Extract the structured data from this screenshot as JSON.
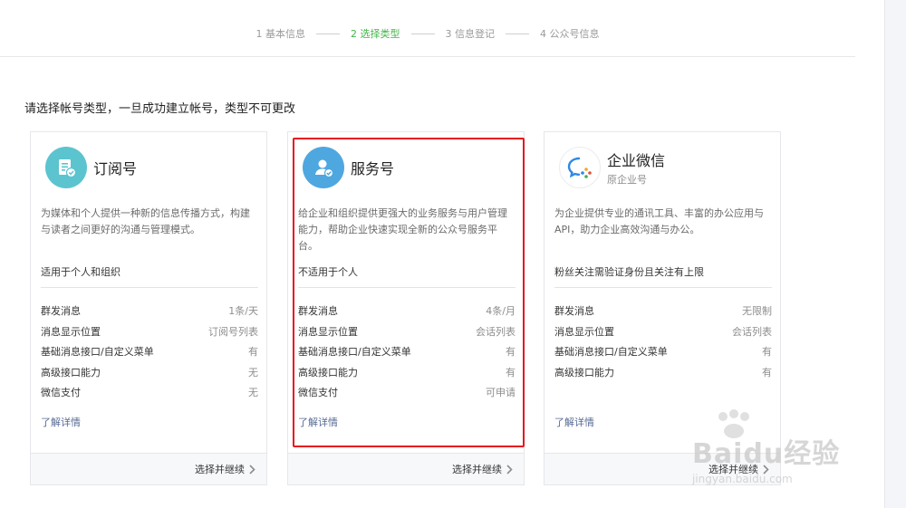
{
  "steps": [
    {
      "label": "1 基本信息",
      "active": false
    },
    {
      "label": "2 选择类型",
      "active": true
    },
    {
      "label": "3 信息登记",
      "active": false
    },
    {
      "label": "4 公众号信息",
      "active": false
    }
  ],
  "page_title": "请选择帐号类型，一旦成功建立帐号，类型不可更改",
  "cards": [
    {
      "name": "订阅号",
      "subtitle": "",
      "icon": "subscription-doc-icon",
      "icon_color": "#5bc4cf",
      "desc": "为媒体和个人提供一种新的信息传播方式，构建与读者之间更好的沟通与管理模式。",
      "fit": "适用于个人和组织",
      "features": [
        {
          "label": "群发消息",
          "value": "1条/天"
        },
        {
          "label": "消息显示位置",
          "value": "订阅号列表"
        },
        {
          "label": "基础消息接口/自定义菜单",
          "value": "有"
        },
        {
          "label": "高级接口能力",
          "value": "无"
        },
        {
          "label": "微信支付",
          "value": "无"
        }
      ],
      "learn_more": "了解详情",
      "select_label": "选择并继续"
    },
    {
      "name": "服务号",
      "subtitle": "",
      "icon": "service-user-icon",
      "icon_color": "#4fa7e0",
      "desc": "给企业和组织提供更强大的业务服务与用户管理能力，帮助企业快速实现全新的公众号服务平台。",
      "fit": "不适用于个人",
      "features": [
        {
          "label": "群发消息",
          "value": "4条/月"
        },
        {
          "label": "消息显示位置",
          "value": "会话列表"
        },
        {
          "label": "基础消息接口/自定义菜单",
          "value": "有"
        },
        {
          "label": "高级接口能力",
          "value": "有"
        },
        {
          "label": "微信支付",
          "value": "可申请"
        }
      ],
      "learn_more": "了解详情",
      "select_label": "选择并继续"
    },
    {
      "name": "企业微信",
      "subtitle": "原企业号",
      "icon": "work-wechat-icon",
      "icon_color": "#2e89e6",
      "desc": "为企业提供专业的通讯工具、丰富的办公应用与API，助力企业高效沟通与办公。",
      "fit": "粉丝关注需验证身份且关注有上限",
      "features": [
        {
          "label": "群发消息",
          "value": "无限制"
        },
        {
          "label": "消息显示位置",
          "value": "会话列表"
        },
        {
          "label": "基础消息接口/自定义菜单",
          "value": "有"
        },
        {
          "label": "高级接口能力",
          "value": "有"
        }
      ],
      "learn_more": "了解详情",
      "select_label": "选择并继续"
    }
  ],
  "watermark": {
    "brand": "Baidu经验",
    "url": "jingyan.baidu.com"
  },
  "colors": {
    "active_step": "#44b549",
    "link": "#576b95",
    "highlight": "#e5161f"
  }
}
